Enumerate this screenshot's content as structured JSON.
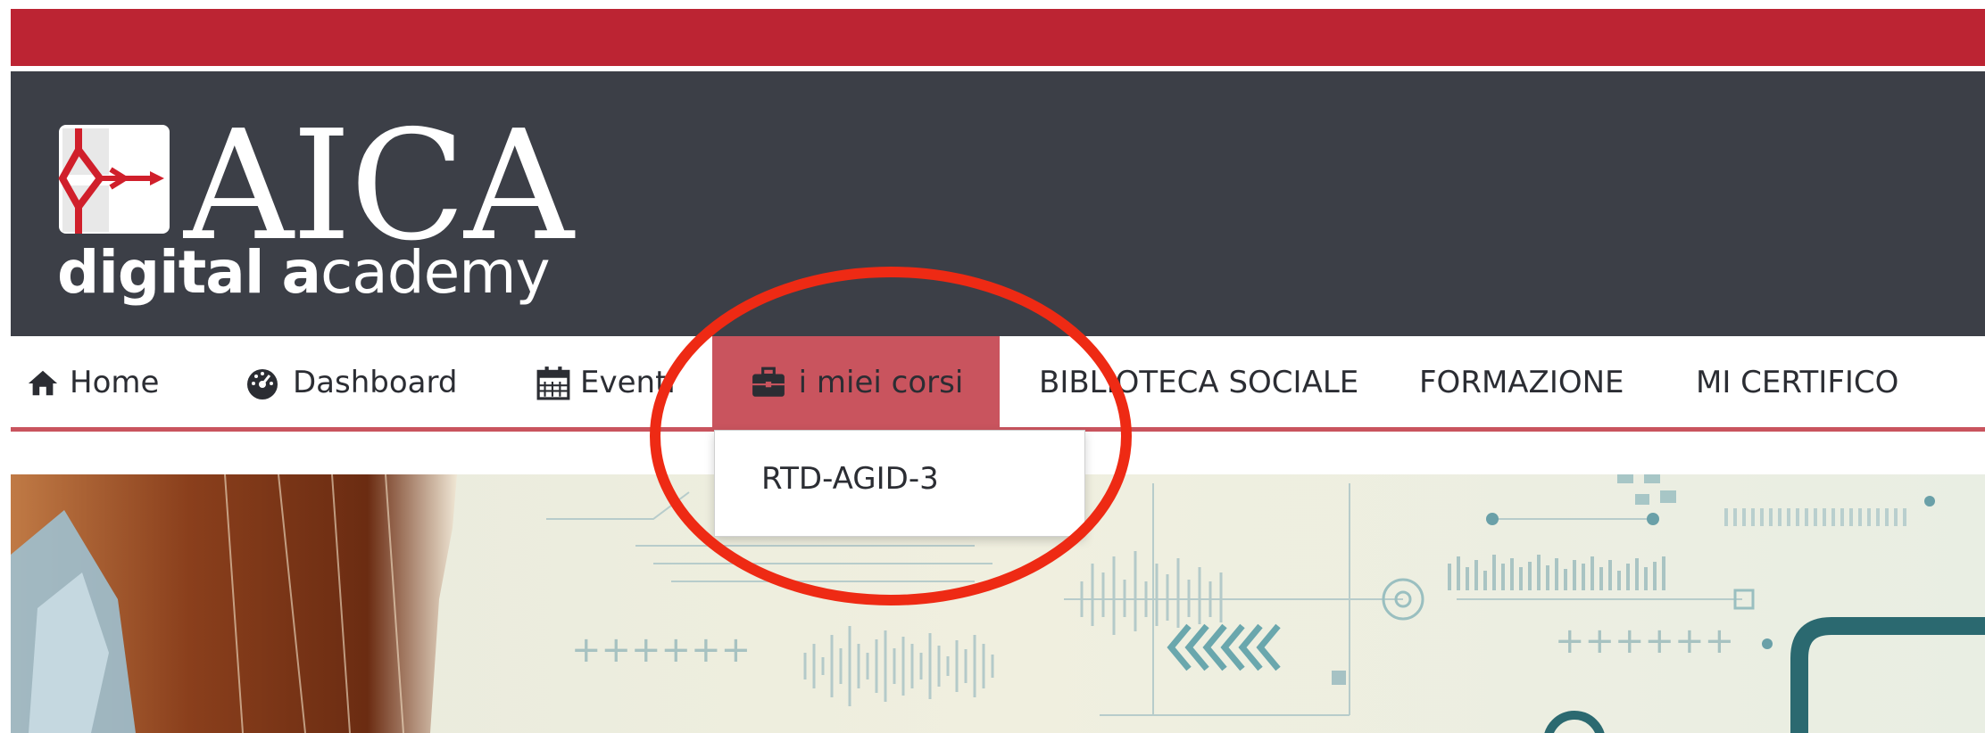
{
  "colors": {
    "brand_red": "#bc2433",
    "header_dark": "#3c3f47",
    "active_tab": "#c9545e",
    "callout_red": "#ee2a14"
  },
  "logo": {
    "word": "AICA",
    "sub_bold_1": "digital",
    "sub_bold_2": "a",
    "sub_rest": "cademy"
  },
  "nav": {
    "items": [
      {
        "label": "Home",
        "icon": "home-icon"
      },
      {
        "label": "Dashboard",
        "icon": "dashboard-icon"
      },
      {
        "label": "Eventi",
        "icon": "calendar-icon"
      },
      {
        "label": "i miei corsi",
        "icon": "briefcase-icon",
        "active": true
      },
      {
        "label": "BIBLIOTECA SOCIALE"
      },
      {
        "label": "FORMAZIONE"
      },
      {
        "label": "MI CERTIFICO"
      }
    ]
  },
  "dropdown": {
    "items": [
      "RTD-AGID-3"
    ]
  }
}
